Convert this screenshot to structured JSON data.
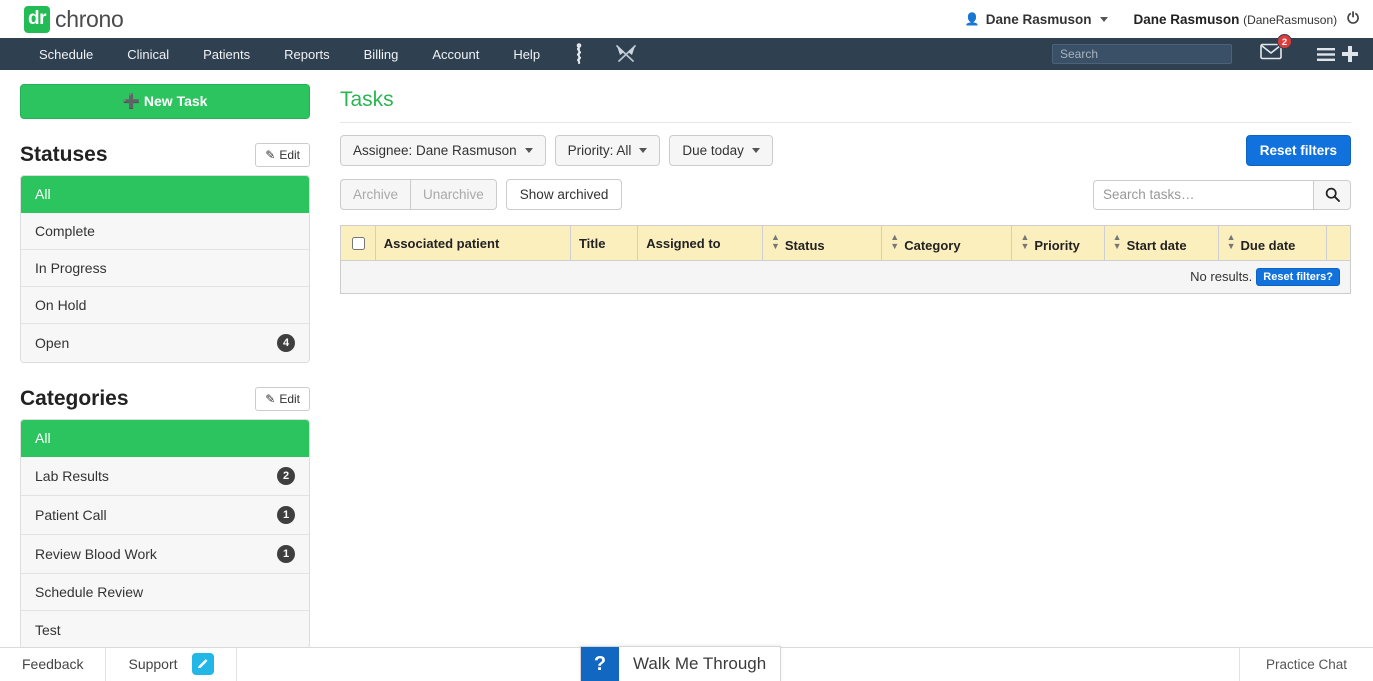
{
  "brand": {
    "logo_badge": "dr",
    "logo_word": "chrono",
    "green": "#2cc45f",
    "navy": "#2f4050",
    "blue": "#1272dd"
  },
  "topbar": {
    "user_menu_label": "Dane Rasmuson",
    "user_icon": "user-icon",
    "account_name": "Dane Rasmuson",
    "account_username": "(DaneRasmuson)",
    "power_icon": "power-icon"
  },
  "nav": {
    "items": [
      {
        "label": "Schedule"
      },
      {
        "label": "Clinical"
      },
      {
        "label": "Patients"
      },
      {
        "label": "Reports"
      },
      {
        "label": "Billing"
      },
      {
        "label": "Account"
      },
      {
        "label": "Help"
      }
    ],
    "icons": [
      {
        "name": "caduceus-icon"
      },
      {
        "name": "crossed-scalpels-icon"
      }
    ],
    "search_placeholder": "Search",
    "search_value": "",
    "mail_icon": "envelope-icon",
    "mail_badge": "2",
    "menu_icon": "hamburger-icon",
    "add_icon": "plus-icon"
  },
  "sidebar": {
    "new_task_label": "New Task",
    "new_task_icon": "plus-icon",
    "statuses": {
      "title": "Statuses",
      "edit_label": "Edit",
      "edit_icon": "pencil-icon",
      "items": [
        {
          "label": "All",
          "count": "",
          "active": true
        },
        {
          "label": "Complete",
          "count": "",
          "active": false
        },
        {
          "label": "In Progress",
          "count": "",
          "active": false
        },
        {
          "label": "On Hold",
          "count": "",
          "active": false
        },
        {
          "label": "Open",
          "count": "4",
          "active": false
        }
      ]
    },
    "categories": {
      "title": "Categories",
      "edit_label": "Edit",
      "edit_icon": "pencil-icon",
      "items": [
        {
          "label": "All",
          "count": "",
          "active": true
        },
        {
          "label": "Lab Results",
          "count": "2",
          "active": false
        },
        {
          "label": "Patient Call",
          "count": "1",
          "active": false
        },
        {
          "label": "Review Blood Work",
          "count": "1",
          "active": false
        },
        {
          "label": "Schedule Review",
          "count": "",
          "active": false
        },
        {
          "label": "Test",
          "count": "",
          "active": false
        }
      ]
    }
  },
  "main": {
    "title": "Tasks",
    "filters": [
      {
        "label": "Assignee: Dane Rasmuson"
      },
      {
        "label": "Priority: All"
      },
      {
        "label": "Due today"
      }
    ],
    "reset_filters_label": "Reset filters",
    "archive_label": "Archive",
    "unarchive_label": "Unarchive",
    "show_archived_label": "Show archived",
    "search_placeholder": "Search tasks…",
    "search_value": "",
    "search_icon": "search-icon",
    "table": {
      "columns": [
        {
          "label": "Associated patient",
          "sortable": false
        },
        {
          "label": "Title",
          "sortable": false
        },
        {
          "label": "Assigned to",
          "sortable": false
        },
        {
          "label": "Status",
          "sortable": true
        },
        {
          "label": "Category",
          "sortable": true
        },
        {
          "label": "Priority",
          "sortable": true
        },
        {
          "label": "Start date",
          "sortable": true
        },
        {
          "label": "Due date",
          "sortable": true
        }
      ],
      "select_all_checkbox": false,
      "rows": [],
      "empty_text": "No results.",
      "empty_action_label": "Reset filters?"
    }
  },
  "footer": {
    "feedback_label": "Feedback",
    "support_label": "Support",
    "pencil_icon": "pencil-icon",
    "walkme_q": "?",
    "walkme_label": "Walk Me Through",
    "practice_chat_label": "Practice Chat"
  }
}
